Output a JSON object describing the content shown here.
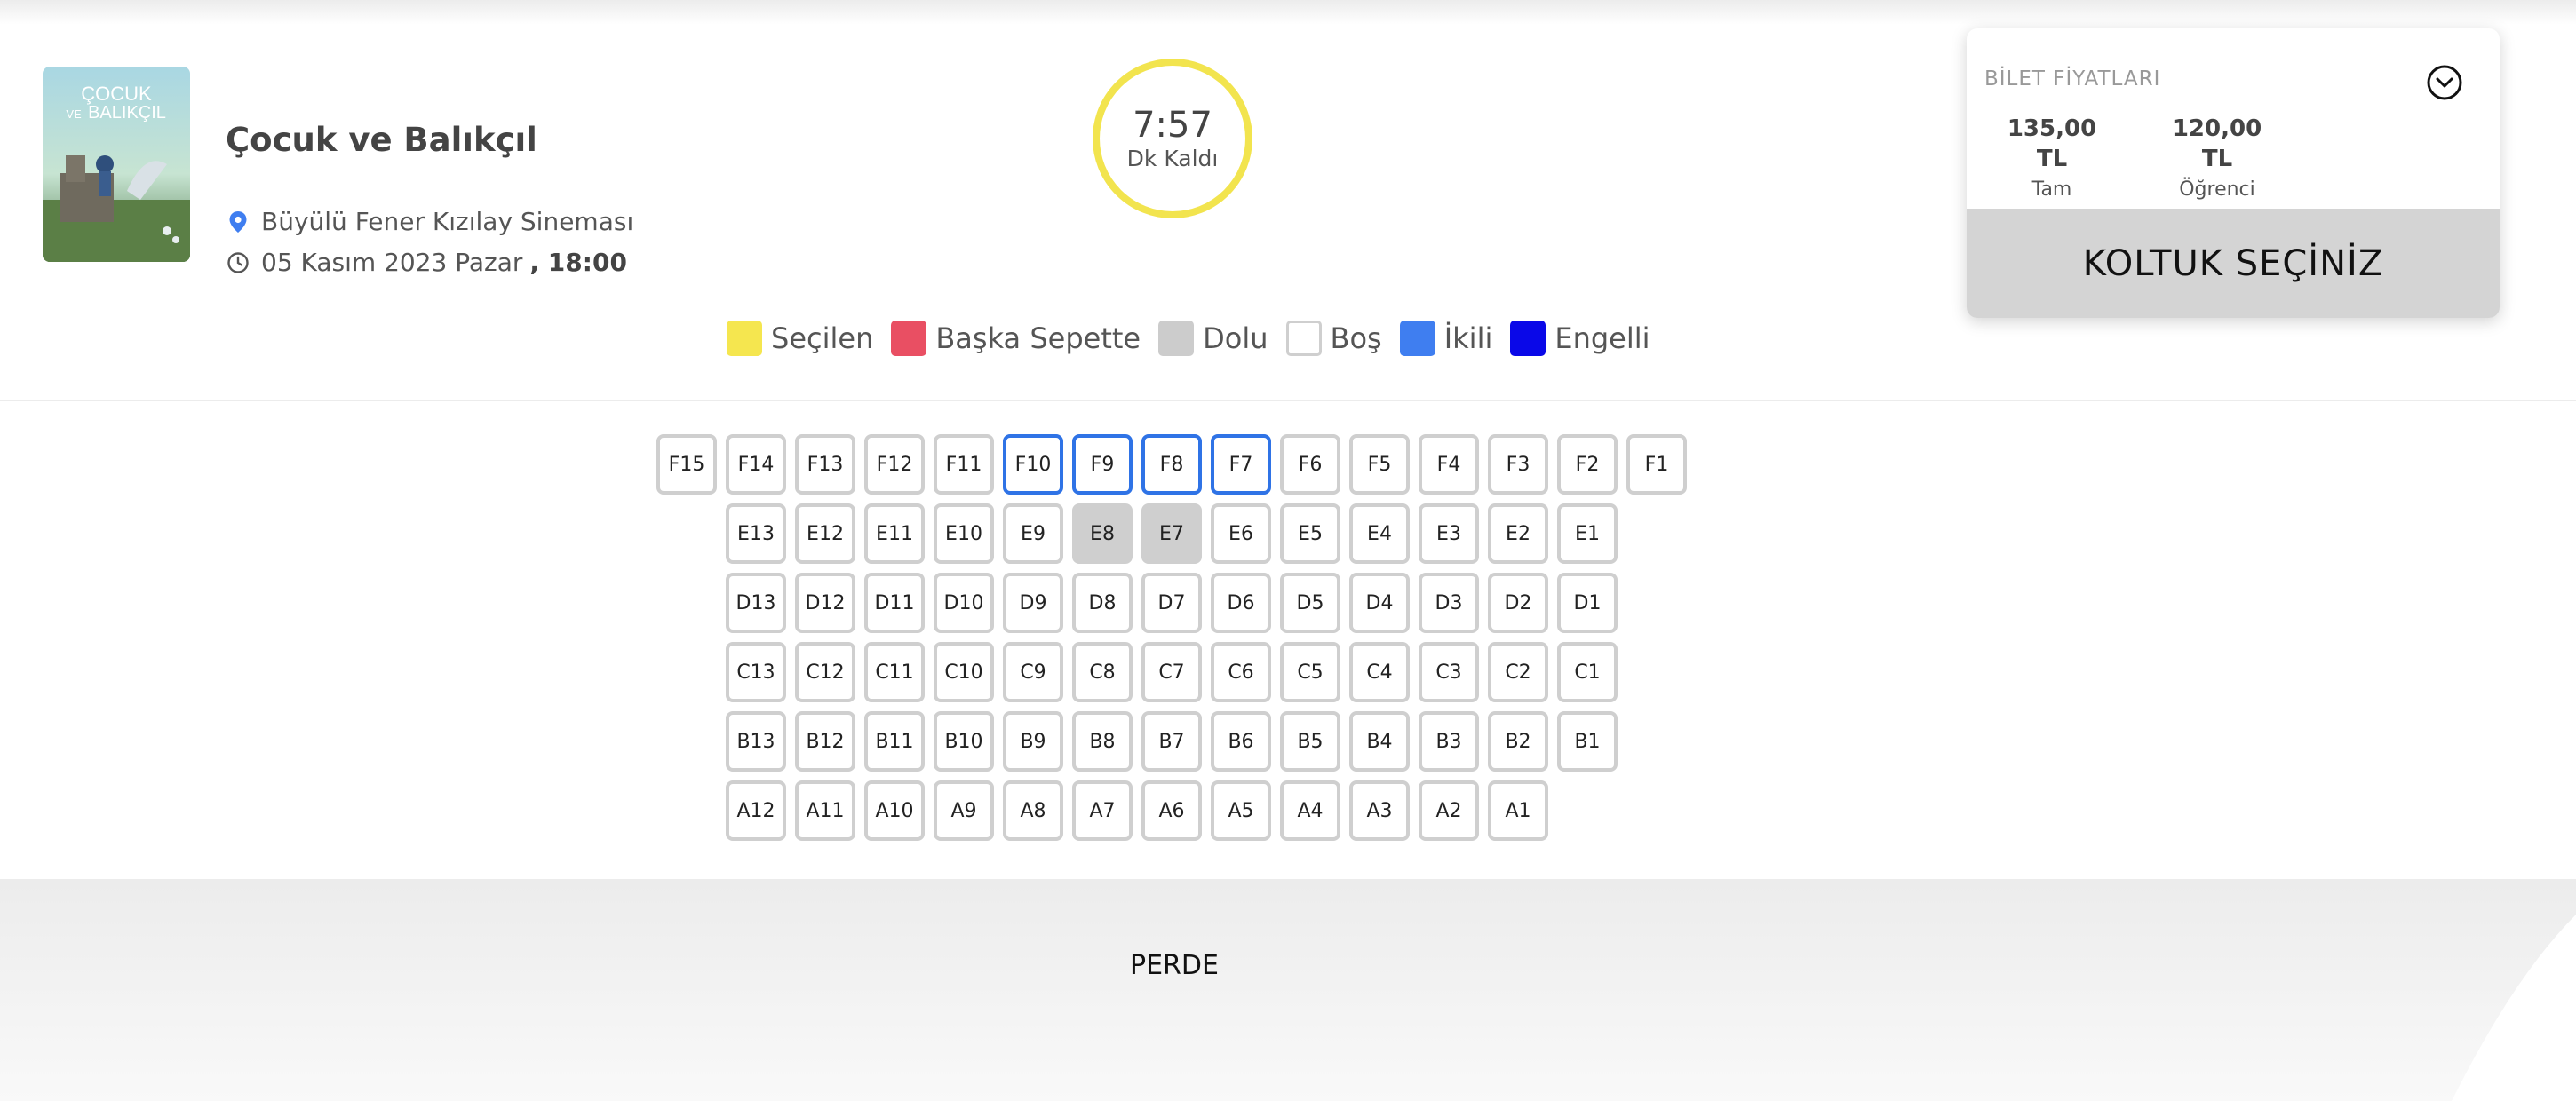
{
  "movie": {
    "title": "Çocuk ve Balıkçıl",
    "poster_text": [
      "ÇOCUK",
      "VE",
      "BALIKÇIL"
    ],
    "location": "Büyülü Fener Kızılay Sineması",
    "date": "05 Kasım 2023 Pazar",
    "time": ", 18:00",
    "icons": {
      "location": "location-pin-icon",
      "clock": "clock-icon"
    }
  },
  "timer": {
    "time": "7:57",
    "label": "Dk Kaldı",
    "ring_color": "#f2e44e"
  },
  "legend": [
    {
      "label": "Seçilen",
      "color": "#f5e64f"
    },
    {
      "label": "Başka Sepette",
      "color": "#e94f63"
    },
    {
      "label": "Dolu",
      "color": "#cccccc"
    },
    {
      "label": "Boş",
      "color": "#ffffff"
    },
    {
      "label": "İkili",
      "color": "#3f7ef0"
    },
    {
      "label": "Engelli",
      "color": "#0a08e8"
    }
  ],
  "prices": {
    "title": "BİLET FİYATLARI",
    "items": [
      {
        "amount": "135,00 TL",
        "label": "Tam"
      },
      {
        "amount": "120,00 TL",
        "label": "Öğrenci"
      }
    ],
    "button": "KOLTUK SEÇİNİZ",
    "toggle_icon": "chevron-down-circle-icon"
  },
  "seat_rows": [
    {
      "row": "F",
      "seats": [
        {
          "label": "F15",
          "status": "bos"
        },
        {
          "label": "F14",
          "status": "bos"
        },
        {
          "label": "F13",
          "status": "bos"
        },
        {
          "label": "F12",
          "status": "bos"
        },
        {
          "label": "F11",
          "status": "bos"
        },
        {
          "label": "F10",
          "status": "ikili"
        },
        {
          "label": "F9",
          "status": "ikili"
        },
        {
          "label": "F8",
          "status": "ikili"
        },
        {
          "label": "F7",
          "status": "ikili"
        },
        {
          "label": "F6",
          "status": "bos"
        },
        {
          "label": "F5",
          "status": "bos"
        },
        {
          "label": "F4",
          "status": "bos"
        },
        {
          "label": "F3",
          "status": "bos"
        },
        {
          "label": "F2",
          "status": "bos"
        },
        {
          "label": "F1",
          "status": "bos"
        }
      ]
    },
    {
      "row": "E",
      "seats": [
        {
          "label": "E13",
          "status": "bos"
        },
        {
          "label": "E12",
          "status": "bos"
        },
        {
          "label": "E11",
          "status": "bos"
        },
        {
          "label": "E10",
          "status": "bos"
        },
        {
          "label": "E9",
          "status": "bos"
        },
        {
          "label": "E8",
          "status": "dolu"
        },
        {
          "label": "E7",
          "status": "dolu"
        },
        {
          "label": "E6",
          "status": "bos"
        },
        {
          "label": "E5",
          "status": "bos"
        },
        {
          "label": "E4",
          "status": "bos"
        },
        {
          "label": "E3",
          "status": "bos"
        },
        {
          "label": "E2",
          "status": "bos"
        },
        {
          "label": "E1",
          "status": "bos"
        }
      ]
    },
    {
      "row": "D",
      "seats": [
        {
          "label": "D13",
          "status": "bos"
        },
        {
          "label": "D12",
          "status": "bos"
        },
        {
          "label": "D11",
          "status": "bos"
        },
        {
          "label": "D10",
          "status": "bos"
        },
        {
          "label": "D9",
          "status": "bos"
        },
        {
          "label": "D8",
          "status": "bos"
        },
        {
          "label": "D7",
          "status": "bos"
        },
        {
          "label": "D6",
          "status": "bos"
        },
        {
          "label": "D5",
          "status": "bos"
        },
        {
          "label": "D4",
          "status": "bos"
        },
        {
          "label": "D3",
          "status": "bos"
        },
        {
          "label": "D2",
          "status": "bos"
        },
        {
          "label": "D1",
          "status": "bos"
        }
      ]
    },
    {
      "row": "C",
      "seats": [
        {
          "label": "C13",
          "status": "bos"
        },
        {
          "label": "C12",
          "status": "bos"
        },
        {
          "label": "C11",
          "status": "bos"
        },
        {
          "label": "C10",
          "status": "bos"
        },
        {
          "label": "C9",
          "status": "bos"
        },
        {
          "label": "C8",
          "status": "bos"
        },
        {
          "label": "C7",
          "status": "bos"
        },
        {
          "label": "C6",
          "status": "bos"
        },
        {
          "label": "C5",
          "status": "bos"
        },
        {
          "label": "C4",
          "status": "bos"
        },
        {
          "label": "C3",
          "status": "bos"
        },
        {
          "label": "C2",
          "status": "bos"
        },
        {
          "label": "C1",
          "status": "bos"
        }
      ]
    },
    {
      "row": "B",
      "seats": [
        {
          "label": "B13",
          "status": "bos"
        },
        {
          "label": "B12",
          "status": "bos"
        },
        {
          "label": "B11",
          "status": "bos"
        },
        {
          "label": "B10",
          "status": "bos"
        },
        {
          "label": "B9",
          "status": "bos"
        },
        {
          "label": "B8",
          "status": "bos"
        },
        {
          "label": "B7",
          "status": "bos"
        },
        {
          "label": "B6",
          "status": "bos"
        },
        {
          "label": "B5",
          "status": "bos"
        },
        {
          "label": "B4",
          "status": "bos"
        },
        {
          "label": "B3",
          "status": "bos"
        },
        {
          "label": "B2",
          "status": "bos"
        },
        {
          "label": "B1",
          "status": "bos"
        }
      ]
    },
    {
      "row": "A",
      "seats": [
        {
          "label": "A12",
          "status": "bos"
        },
        {
          "label": "A11",
          "status": "bos"
        },
        {
          "label": "A10",
          "status": "bos"
        },
        {
          "label": "A9",
          "status": "bos"
        },
        {
          "label": "A8",
          "status": "bos"
        },
        {
          "label": "A7",
          "status": "bos"
        },
        {
          "label": "A6",
          "status": "bos"
        },
        {
          "label": "A5",
          "status": "bos"
        },
        {
          "label": "A4",
          "status": "bos"
        },
        {
          "label": "A3",
          "status": "bos"
        },
        {
          "label": "A2",
          "status": "bos"
        },
        {
          "label": "A1",
          "status": "bos"
        }
      ]
    }
  ],
  "screen": {
    "label": "PERDE"
  }
}
